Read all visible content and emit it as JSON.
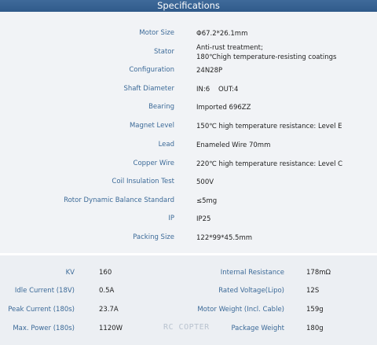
{
  "header": {
    "title": "Specifications"
  },
  "specs": [
    {
      "label": "Motor Size",
      "value": "Φ67.2*26.1mm"
    },
    {
      "label": "Stator",
      "value": "Anti-rust treatment;",
      "value2": "180℃high temperature-resisting coatings"
    },
    {
      "label": "Configuration",
      "value": "24N28P"
    },
    {
      "label": "Shaft Diameter",
      "value": "IN:6    OUT:4"
    },
    {
      "label": "Bearing",
      "value": "Imported 696ZZ"
    },
    {
      "label": "Magnet Level",
      "value": "150℃ high temperature resistance: Level E"
    },
    {
      "label": "Lead",
      "value": "Enameled Wire 70mm"
    },
    {
      "label": "Copper Wire",
      "value": "220℃ high temperature resistance: Level C"
    },
    {
      "label": "Coil Insulation Test",
      "value": "500V"
    },
    {
      "label": "Rotor Dynamic Balance Standard",
      "value": "≤5mg"
    },
    {
      "label": "IP",
      "value": "IP25"
    },
    {
      "label": "Packing Size",
      "value": "122*99*45.5mm"
    }
  ],
  "bottom": [
    {
      "label_l": "KV",
      "value_l": "160",
      "label_r": "Internal Resistance",
      "value_r": "178mΩ"
    },
    {
      "label_l": "Idle Current  (18V)",
      "value_l": "0.5A",
      "label_r": "Rated Voltage(Lipo)",
      "value_r": "12S"
    },
    {
      "label_l": "Peak Current  (180s)",
      "value_l": "23.7A",
      "label_r": "Motor Weight  (Incl. Cable)",
      "value_r": "159g"
    },
    {
      "label_l": "Max. Power  (180s)",
      "value_l": "1120W",
      "label_r": "Package Weight",
      "value_r": "180g"
    }
  ],
  "watermark": "RC COPTER"
}
